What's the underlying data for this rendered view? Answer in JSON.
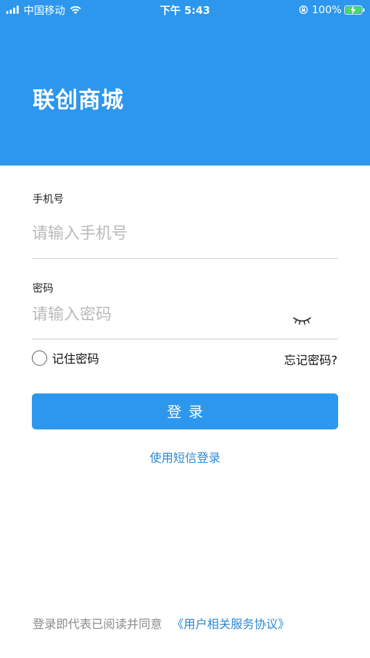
{
  "status_bar": {
    "carrier": "中国移动",
    "time": "下午 5:43",
    "battery": "100%"
  },
  "header": {
    "title": "联创商城",
    "background_color": "#2d97ee"
  },
  "form": {
    "phone": {
      "label": "手机号",
      "placeholder": "请输入手机号",
      "value": ""
    },
    "password": {
      "label": "密码",
      "placeholder": "请输入密码",
      "value": "",
      "toggle_icon": "eye-closed-icon"
    },
    "remember": {
      "label": "记住密码",
      "checked": false
    },
    "forgot_label": "忘记密码?",
    "login_label": "登录",
    "sms_login_label": "使用短信登录"
  },
  "footer": {
    "agreement_prefix": "登录即代表已阅读并同意",
    "agreement_link": "《用户相关服务协议》"
  },
  "colors": {
    "primary": "#2d97ee",
    "link": "#2d88d3"
  }
}
